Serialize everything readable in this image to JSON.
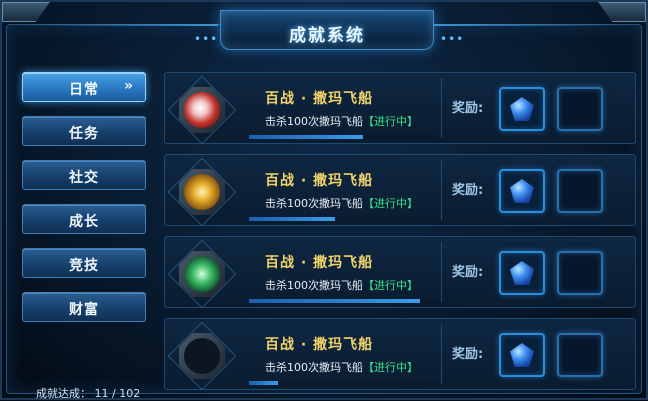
{
  "window": {
    "title": "成就系统",
    "dots_left": "•••",
    "dots_right": "•••"
  },
  "sidebar": {
    "items": [
      {
        "label": "日常",
        "arrow": "»",
        "active": true
      },
      {
        "label": "任务",
        "active": false
      },
      {
        "label": "社交",
        "active": false
      },
      {
        "label": "成长",
        "active": false
      },
      {
        "label": "竞技",
        "active": false
      },
      {
        "label": "财富",
        "active": false
      }
    ],
    "achieved_text": "成就达成：  11 / 102"
  },
  "achievements": [
    {
      "name": "百战 · 撒玛飞船",
      "desc": "击杀100次撒玛飞船",
      "status": "【进行中】",
      "reward_label": "奖励:",
      "icon": "red-swirl-badge-icon",
      "progress": 0.6
    },
    {
      "name": "百战 · 撒玛飞船",
      "desc": "击杀100次撒玛飞船",
      "status": "【进行中】",
      "reward_label": "奖励:",
      "icon": "gold-sun-badge-icon",
      "progress": 0.45
    },
    {
      "name": "百战 · 撒玛飞船",
      "desc": "击杀100次撒玛飞船",
      "status": "【进行中】",
      "reward_label": "奖励:",
      "icon": "green-vortex-badge-icon",
      "progress": 0.9
    },
    {
      "name": "百战 · 撒玛飞船",
      "desc": "击杀100次撒玛飞船",
      "status": "【进行中】",
      "reward_label": "奖励:",
      "icon": "empty-badge-frame-icon",
      "progress": 0.15
    }
  ],
  "colors": {
    "accent": "#3a9ce8",
    "title_gold": "#f2d36b",
    "status_green": "#38e38a"
  }
}
